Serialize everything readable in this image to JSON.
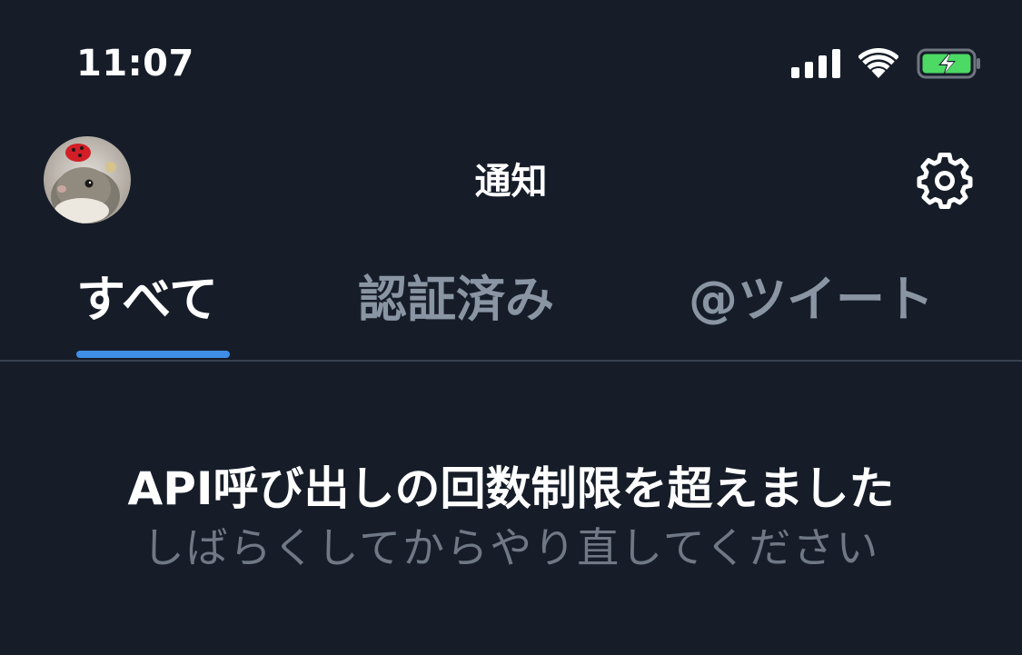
{
  "status_bar": {
    "time": "11:07",
    "signal_icon": "cellular-signal-icon",
    "wifi_icon": "wifi-icon",
    "battery_icon": "battery-charging-icon",
    "battery_color": "#4cd964"
  },
  "header": {
    "title": "通知",
    "avatar_icon": "profile-avatar",
    "settings_icon": "gear-icon"
  },
  "tabs": [
    {
      "label": "すべて",
      "selected": true
    },
    {
      "label": "認証済み",
      "selected": false
    },
    {
      "label": "@ツイート",
      "selected": false
    }
  ],
  "message": {
    "title": "API呼び出しの回数制限を超えました",
    "subtitle": "しばらくしてからやり直してください"
  },
  "colors": {
    "background": "#161d29",
    "accent": "#3f8fe8",
    "inactive_tab": "#8a95a3",
    "subtitle": "#6f7884"
  }
}
